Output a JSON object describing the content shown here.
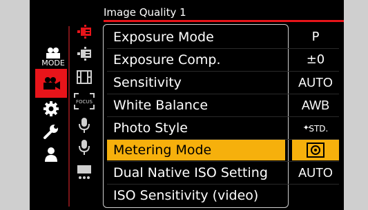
{
  "menu": {
    "title": "Image Quality 1",
    "items": [
      {
        "label": "Exposure Mode",
        "value": "P"
      },
      {
        "label": "Exposure Comp.",
        "value": "±0"
      },
      {
        "label": "Sensitivity",
        "value": "AUTO"
      },
      {
        "label": "White Balance",
        "value": "AWB"
      },
      {
        "label": "Photo Style",
        "value": "STD."
      },
      {
        "label": "Metering Mode",
        "value": ""
      },
      {
        "label": "Dual Native ISO Setting",
        "value": "AUTO"
      },
      {
        "label": "ISO Sensitivity (video)",
        "value": ""
      }
    ],
    "selected_index": 5
  },
  "tabs": {
    "mode_label": "MODE",
    "focus_label": "FOCUS"
  },
  "colors": {
    "accent": "#e8141a",
    "highlight": "#f6b00c",
    "background": "#000000",
    "bezel": "#cfcfcf"
  },
  "icons": [
    "mode-icon",
    "video-camera-icon",
    "gear-icon",
    "wrench-icon",
    "person-icon",
    "image-quality-icon",
    "image-quality-icon",
    "film-icon",
    "focus-icon",
    "microphone-icon",
    "microphone-icon",
    "monitor-icon"
  ]
}
